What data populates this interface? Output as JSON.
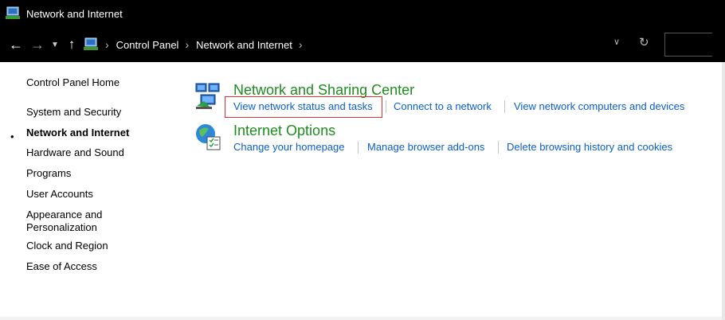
{
  "window": {
    "title": "Network and Internet"
  },
  "address": {
    "breadcrumbs": [
      "Control Panel",
      "Network and Internet"
    ]
  },
  "sidebar": {
    "items": [
      {
        "label": "Control Panel Home"
      },
      {
        "label": "System and Security"
      },
      {
        "label": "Network and Internet",
        "current": true
      },
      {
        "label": "Hardware and Sound"
      },
      {
        "label": "Programs"
      },
      {
        "label": "User Accounts"
      },
      {
        "label": "Appearance and\nPersonalization"
      },
      {
        "label": "Clock and Region"
      },
      {
        "label": "Ease of Access"
      }
    ]
  },
  "categories": [
    {
      "title": "Network and Sharing Center",
      "icon": "network-sharing-icon",
      "links": [
        "View network status and tasks",
        "Connect to a network",
        "View network computers and devices"
      ]
    },
    {
      "title": "Internet Options",
      "icon": "internet-options-icon",
      "links": [
        "Change your homepage",
        "Manage browser add-ons",
        "Delete browsing history and cookies"
      ]
    }
  ],
  "colors": {
    "titlebar": "#000000",
    "category_title": "#1e8c1e",
    "link": "#0a5fc8",
    "highlight": "#e03030"
  }
}
